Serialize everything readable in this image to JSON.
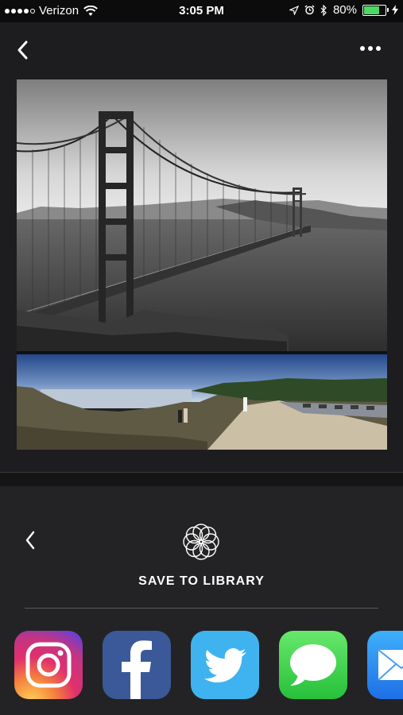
{
  "status_bar": {
    "carrier": "Verizon",
    "time": "3:05 PM",
    "battery_percent": "80%",
    "battery_level": 0.8,
    "signal_bars": 4
  },
  "share_panel": {
    "save_label": "SAVE TO LIBRARY"
  },
  "apps": [
    "Instagram",
    "Facebook",
    "Twitter",
    "Messages",
    "Mail"
  ],
  "colors": {
    "background": "#1d1d1f",
    "panel": "#232325",
    "instagram_gradient": [
      "#f9ce34",
      "#ee2a7b",
      "#6228d7"
    ],
    "facebook": "#3b5998",
    "twitter": "#1da1f2",
    "messages": "#4cd964",
    "mail": "#2e9bf6"
  }
}
